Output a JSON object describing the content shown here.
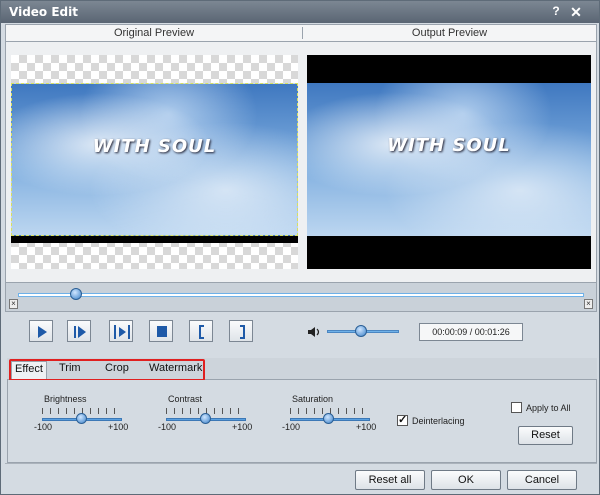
{
  "window": {
    "title": "Video Edit",
    "help_glyph": "?",
    "close_glyph": "✕"
  },
  "preview": {
    "original_label": "Original Preview",
    "output_label": "Output Preview",
    "caption": "WITH SOUL"
  },
  "timeline": {
    "position_fraction": 0.095
  },
  "controls": {
    "play_icon": "play-icon",
    "next_frame_icon": "next-frame-icon",
    "play_selection_icon": "play-selection-icon",
    "stop_icon": "stop-icon",
    "mark_in_label": "[",
    "mark_out_label": "]",
    "volume_fraction": 0.45,
    "time_display": "00:00:09 / 00:01:26"
  },
  "tabs": [
    {
      "label": "Effect",
      "active": true
    },
    {
      "label": "Trim",
      "active": false
    },
    {
      "label": "Crop",
      "active": false
    },
    {
      "label": "Watermark",
      "active": false
    }
  ],
  "effect": {
    "brightness": {
      "label": "Brightness",
      "min": "-100",
      "max": "+100",
      "value": 0
    },
    "contrast": {
      "label": "Contrast",
      "min": "-100",
      "max": "+100",
      "value": 0
    },
    "saturation": {
      "label": "Saturation",
      "min": "-100",
      "max": "+100",
      "value": 0
    },
    "deinterlacing": {
      "label": "Deinterlacing",
      "checked": true
    },
    "apply_to_all": {
      "label": "Apply to All",
      "checked": false
    },
    "reset_label": "Reset"
  },
  "footer": {
    "reset_all_label": "Reset all",
    "ok_label": "OK",
    "cancel_label": "Cancel"
  },
  "colors": {
    "accent": "#3a80c8",
    "highlight": "#e02020",
    "titlebar": "#6a7582"
  }
}
